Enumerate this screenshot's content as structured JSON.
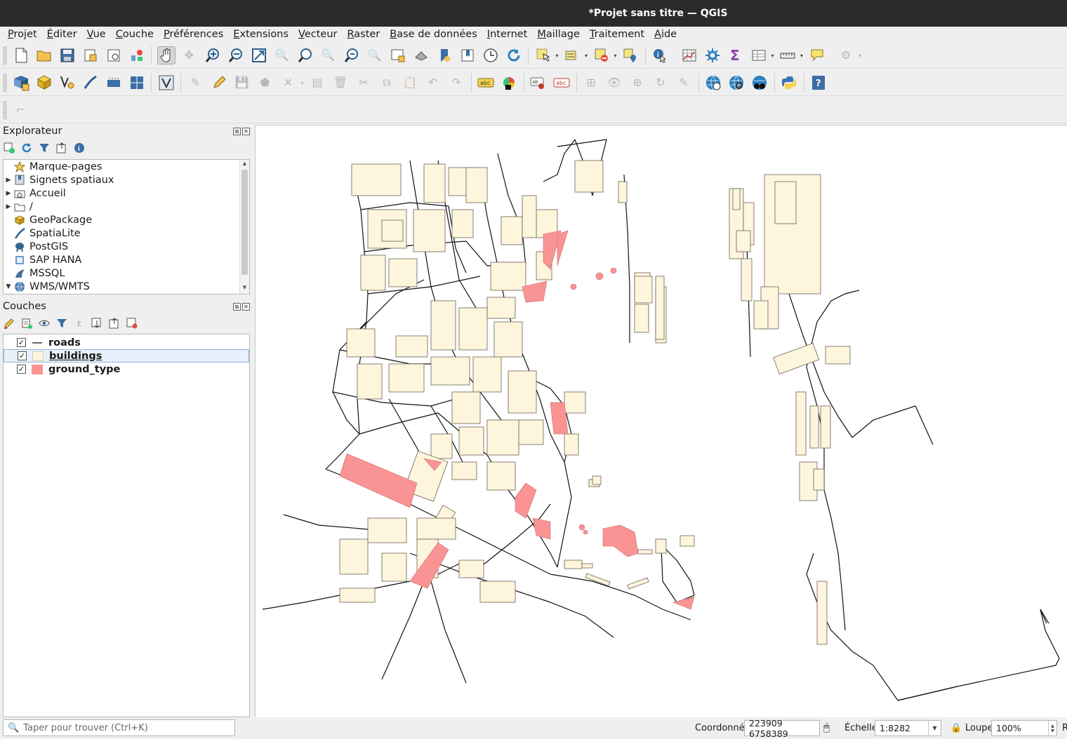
{
  "window": {
    "title": "*Projet sans titre — QGIS"
  },
  "menu": [
    {
      "label": "Projet",
      "key": "P"
    },
    {
      "label": "Éditer",
      "key": "É"
    },
    {
      "label": "Vue",
      "key": "V"
    },
    {
      "label": "Couche",
      "key": "C"
    },
    {
      "label": "Préférences",
      "key": "P"
    },
    {
      "label": "Extensions",
      "key": "E"
    },
    {
      "label": "Vecteur",
      "key": "V"
    },
    {
      "label": "Raster",
      "key": "R"
    },
    {
      "label": "Base de données",
      "key": "B"
    },
    {
      "label": "Internet",
      "key": "I"
    },
    {
      "label": "Maillage",
      "key": "M"
    },
    {
      "label": "Traitement",
      "key": "T"
    },
    {
      "label": "Aide",
      "key": "A"
    }
  ],
  "browser": {
    "title": "Explorateur",
    "items": [
      {
        "label": "Marque-pages",
        "icon": "star-icon",
        "expandable": false
      },
      {
        "label": "Signets spatiaux",
        "icon": "spatial-bookmark-icon",
        "expandable": true
      },
      {
        "label": "Accueil",
        "icon": "home-folder-icon",
        "expandable": true
      },
      {
        "label": "/",
        "icon": "folder-icon",
        "expandable": true
      },
      {
        "label": "GeoPackage",
        "icon": "geopackage-icon",
        "expandable": false
      },
      {
        "label": "SpatiaLite",
        "icon": "spatialite-icon",
        "expandable": false
      },
      {
        "label": "PostGIS",
        "icon": "postgis-icon",
        "expandable": false
      },
      {
        "label": "SAP HANA",
        "icon": "sap-hana-icon",
        "expandable": false
      },
      {
        "label": "MSSQL",
        "icon": "mssql-icon",
        "expandable": false
      },
      {
        "label": "WMS/WMTS",
        "icon": "wms-globe-icon",
        "expandable": true,
        "expanded": true
      }
    ]
  },
  "layers": {
    "title": "Couches",
    "items": [
      {
        "name": "roads",
        "checked": true,
        "symbol": "line",
        "color": "#333333"
      },
      {
        "name": "buildings",
        "checked": true,
        "symbol": "fill",
        "color": "#fdf5dc",
        "active": true
      },
      {
        "name": "ground_type",
        "checked": true,
        "symbol": "fill",
        "color": "#f99394"
      }
    ]
  },
  "status": {
    "search_placeholder": "Taper pour trouver (Ctrl+K)",
    "coord_label": "Coordonnée",
    "coord_value": "223909 6758389",
    "scale_label": "Échelle",
    "scale_value": "1:8282",
    "magnifier_label": "Loupe",
    "magnifier_value": "100%",
    "rotation_label": "R"
  },
  "colors": {
    "building_fill": "#fdf5dc",
    "building_stroke": "#6b6357",
    "ground_fill": "#f99394",
    "road": "#111111"
  }
}
